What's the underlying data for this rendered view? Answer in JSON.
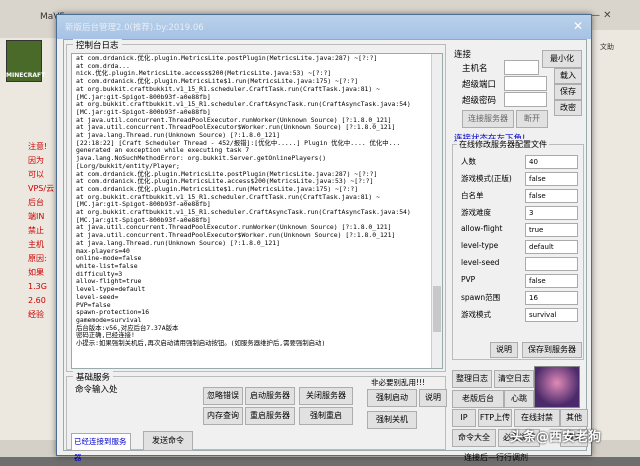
{
  "background": {
    "title": "MaV5",
    "logo_text": "MINECRAFT",
    "left_lines": [
      "注意!",
      "因为",
      "可以",
      "VPS/云",
      "后台",
      "端IN",
      "禁止",
      "主机",
      "原因:",
      "如果",
      "1.3G",
      "2.60",
      "经验"
    ],
    "plugin_tab": "文助",
    "preview": "预览"
  },
  "window": {
    "title": "新版后台管理2.0(推荐).by:2019.06"
  },
  "console": {
    "legend": "控制台日志",
    "lines": [
      "at com.drdanick.优化.plugin.MetricsLite.postPlugin(MetricsLite.java:287) ~[?:?]",
      "at com.drda...",
      "nick.优化.plugin.MetricsLite.access$200(MetricsLite.java:53) ~[?:?]",
      "at com.drdanick.优化.plugin.MetricsLite$1.run(MetricsLite.java:175) ~[?:?]",
      "at org.bukkit.craftbukkit.v1_15_R1.scheduler.CraftTask.run(CraftTask.java:81) ~",
      "[MC.jar:git-Spigot-800b93f-a0e88fb]",
      "at org.bukkit.craftbukkit.v1_15_R1.scheduler.CraftAsyncTask.run(CraftAsyncTask.java:54)",
      "[MC.jar:git-Spigot-800b93f-a0e88fb]",
      "at java.util.concurrent.ThreadPoolExecutor.runWorker(Unknown Source) [?:1.8.0_121]",
      "at java.util.concurrent.ThreadPoolExecutor$Worker.run(Unknown Source) [?:1.8.0_121]",
      "at java.lang.Thread.run(Unknown Source) [?:1.8.0_121]",
      "[22:18:22] [Craft Scheduler Thread - 452/报错]:[优化中.....] Plugin 优化中.... 优化中...",
      "generated an exception while executing task 7",
      "java.lang.NoSuchMethodError: org.bukkit.Server.getOnlinePlayers()",
      "[Lorg/bukkit/entity/Player;",
      "at com.drdanick.优化.plugin.MetricsLite.postPlugin(MetricsLite.java:287) ~[?:?]",
      "at com.drdanick.优化.plugin.MetricsLite.access$200(MetricsLite.java:53) ~[?:?]",
      "at com.drdanick.优化.plugin.MetricsLite$1.run(MetricsLite.java:175) ~[?:?]",
      "at org.bukkit.craftbukkit.v1_15_R1.scheduler.CraftTask.run(CraftTask.java:81) ~",
      "[MC.jar:git-Spigot-800b93f-a0e88fb]",
      "at org.bukkit.craftbukkit.v1_15_R1.scheduler.CraftAsyncTask.run(CraftAsyncTask.java:54)",
      "[MC.jar:git-Spigot-800b93f-a0e88fb]",
      "at java.util.concurrent.ThreadPoolExecutor.runWorker(Unknown Source) [?:1.8.0_121]",
      "at java.util.concurrent.ThreadPoolExecutor$Worker.run(Unknown Source) [?:1.8.0_121]",
      "at java.lang.Thread.run(Unknown Source) [?:1.8.0_121]",
      "max-players=40",
      "online-mode=false",
      "white-list=false",
      "difficulty=3",
      "allow-flight=true",
      "level-type=default",
      "level-seed=",
      "PVP=false",
      "spawn-protection=16",
      "gamemode=survival",
      "后台版本:v56,对应后台7.37A版本",
      "密码正确,已经连接!",
      "小提示:如果强制关机后,再次启动请用强制启动按钮。(如服务器维护后,需要强制启动)"
    ]
  },
  "connection": {
    "label": "连接",
    "host_label": "主机名",
    "host_value": "",
    "port_label": "超级端口",
    "pwd_label": "超级密码",
    "minimize": "最小化",
    "load": "载入",
    "save": "保存",
    "modify": "改密",
    "connect": "连接服务器",
    "disconnect": "断开",
    "status": "连接状态在左下角!"
  },
  "config": {
    "legend": "在线修改服务器配置文件",
    "rows": [
      {
        "label": "人数",
        "value": "40"
      },
      {
        "label": "游戏模式(正版)",
        "value": "false"
      },
      {
        "label": "白名单",
        "value": "false"
      },
      {
        "label": "游戏难度",
        "value": "3"
      },
      {
        "label": "allow-flight",
        "value": "true"
      },
      {
        "label": "level-type",
        "value": "default"
      },
      {
        "label": "level-seed",
        "value": ""
      },
      {
        "label": "PVP",
        "value": "false"
      },
      {
        "label": "spawn范围",
        "value": "16"
      },
      {
        "label": "游戏模式",
        "value": "survival"
      }
    ],
    "explain": "说明",
    "save_cfg": "保存到服务器"
  },
  "tools": {
    "sort_log": "整理日志",
    "clear_log": "清空日志",
    "old_backend": "老版后台",
    "xinpao": "心跳",
    "ip": "IP",
    "ftp": "FTP上传",
    "explain2": "在线封禁",
    "other": "其他",
    "cmd": "命令大全",
    "must": "必看说明",
    "mode": "模式"
  },
  "basic": {
    "legend": "基础服务",
    "cmd_input_label": "命令输入处",
    "conn_status": "已经连接到服务器",
    "send": "发送命令",
    "sj": "忽略错误",
    "launch": "启动服务器",
    "close": "关闭服务器",
    "query": "内存查询",
    "restart": "重启服务器",
    "force_restart": "强制重启",
    "must_see": "非必要别乱用!!!",
    "force_launch": "强制启动",
    "force_close": "强制关机",
    "explain_bottom": "说明"
  },
  "status_bar": "连接后—行行调剂",
  "watermark": "头条@西安老狗"
}
